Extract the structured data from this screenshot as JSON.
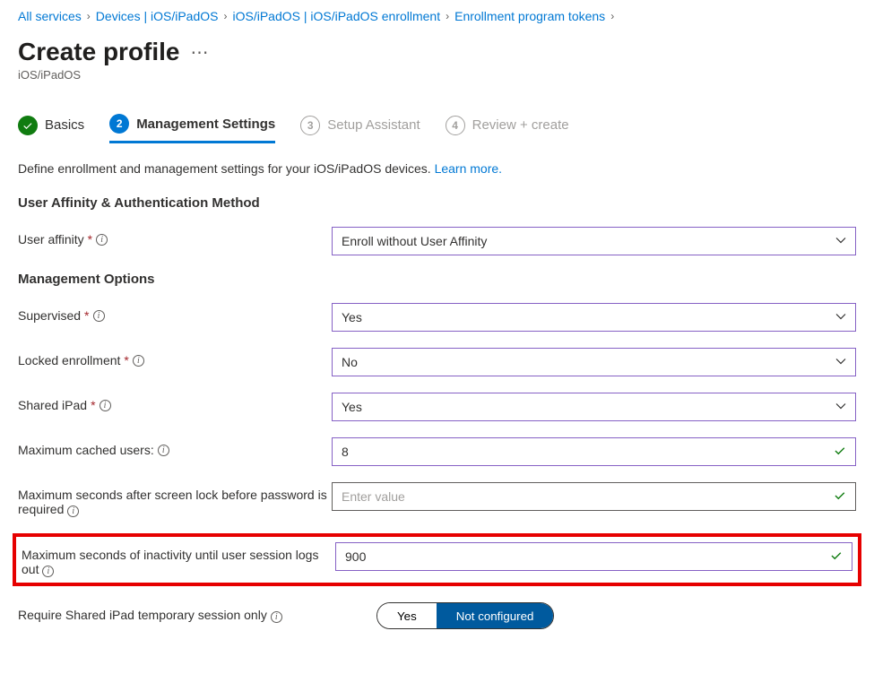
{
  "breadcrumb": [
    {
      "label": "All services"
    },
    {
      "label": "Devices | iOS/iPadOS"
    },
    {
      "label": "iOS/iPadOS | iOS/iPadOS enrollment"
    },
    {
      "label": "Enrollment program tokens"
    }
  ],
  "page": {
    "title": "Create profile",
    "subtitle": "iOS/iPadOS"
  },
  "tabs": [
    {
      "num": "✓",
      "label": "Basics",
      "state": "completed"
    },
    {
      "num": "2",
      "label": "Management Settings",
      "state": "active"
    },
    {
      "num": "3",
      "label": "Setup Assistant",
      "state": "pending"
    },
    {
      "num": "4",
      "label": "Review + create",
      "state": "pending"
    }
  ],
  "intro": {
    "text": "Define enrollment and management settings for your iOS/iPadOS devices. ",
    "link": "Learn more."
  },
  "sections": {
    "affinity_header": "User Affinity & Authentication Method",
    "mgmt_header": "Management Options"
  },
  "fields": {
    "user_affinity": {
      "label": "User affinity",
      "value": "Enroll without User Affinity"
    },
    "supervised": {
      "label": "Supervised",
      "value": "Yes"
    },
    "locked": {
      "label": "Locked enrollment",
      "value": "No"
    },
    "shared": {
      "label": "Shared iPad",
      "value": "Yes"
    },
    "max_users": {
      "label": "Maximum cached users:",
      "value": "8"
    },
    "max_lock": {
      "label": "Maximum seconds after screen lock before password is required",
      "placeholder": "Enter value"
    },
    "max_inactive": {
      "label": "Maximum seconds of inactivity until user session logs out",
      "value": "900"
    },
    "temp_session": {
      "label": "Require Shared iPad temporary session only",
      "opt_yes": "Yes",
      "opt_no": "Not configured"
    }
  }
}
